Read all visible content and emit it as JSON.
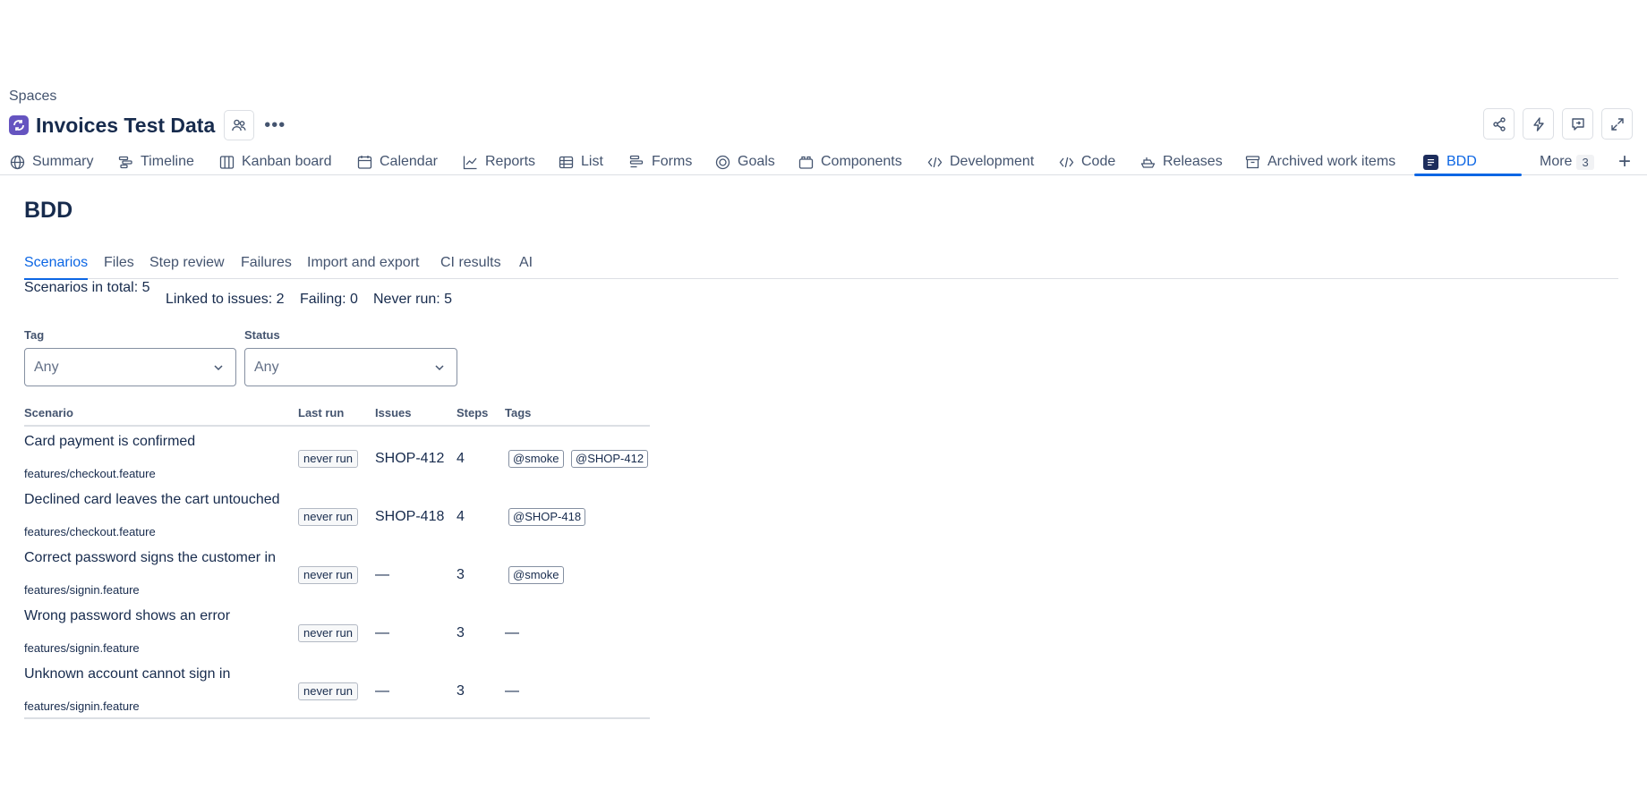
{
  "breadcrumb": "Spaces",
  "project": {
    "title": "Invoices Test Data"
  },
  "colors": {
    "accent": "#0c66e4",
    "project_avatar": "#6554c0",
    "bdd_icon": "#1d2d5c"
  },
  "header_actions": [
    "share-icon",
    "automation-icon",
    "feedback-icon",
    "fullscreen-icon"
  ],
  "nav": {
    "items": [
      {
        "label": "Summary",
        "icon": "globe-icon"
      },
      {
        "label": "Timeline",
        "icon": "timeline-icon"
      },
      {
        "label": "Kanban board",
        "icon": "board-icon"
      },
      {
        "label": "Calendar",
        "icon": "calendar-icon"
      },
      {
        "label": "Reports",
        "icon": "chart-icon"
      },
      {
        "label": "List",
        "icon": "list-icon"
      },
      {
        "label": "Forms",
        "icon": "forms-icon"
      },
      {
        "label": "Goals",
        "icon": "target-icon"
      },
      {
        "label": "Components",
        "icon": "components-icon"
      },
      {
        "label": "Development",
        "icon": "code-icon"
      },
      {
        "label": "Code",
        "icon": "code-icon"
      },
      {
        "label": "Releases",
        "icon": "ship-icon"
      },
      {
        "label": "Archived work items",
        "icon": "archive-icon"
      },
      {
        "label": "BDD",
        "icon": "bdd-icon",
        "active": true
      }
    ],
    "more_label": "More",
    "more_count": "3"
  },
  "page": {
    "heading": "BDD"
  },
  "subtabs": [
    "Scenarios",
    "Files",
    "Step review",
    "Failures",
    "Import and export",
    "CI results",
    "AI"
  ],
  "stats": {
    "total": "Scenarios in total: 5",
    "linked": "Linked to issues: 2",
    "failing": "Failing: 0",
    "never_run": "Never run: 5"
  },
  "filters": {
    "tag": {
      "label": "Tag",
      "value": "Any"
    },
    "status": {
      "label": "Status",
      "value": "Any"
    }
  },
  "table": {
    "headers": [
      "Scenario",
      "Last run",
      "Issues",
      "Steps",
      "Tags"
    ],
    "rows": [
      {
        "name": "Card payment is confirmed",
        "file": "features/checkout.feature",
        "last_run": "never run",
        "issue": "SHOP-412",
        "steps": "4",
        "tags": [
          "@smoke",
          "@SHOP-412"
        ]
      },
      {
        "name": "Declined card leaves the cart untouched",
        "file": "features/checkout.feature",
        "last_run": "never run",
        "issue": "SHOP-418",
        "steps": "4",
        "tags": [
          "@SHOP-418"
        ]
      },
      {
        "name": "Correct password signs the customer in",
        "file": "features/signin.feature",
        "last_run": "never run",
        "issue": "—",
        "steps": "3",
        "tags": [
          "@smoke"
        ]
      },
      {
        "name": "Wrong password shows an error",
        "file": "features/signin.feature",
        "last_run": "never run",
        "issue": "—",
        "steps": "3",
        "tags": [],
        "tags_empty": "—"
      },
      {
        "name": "Unknown account cannot sign in",
        "file": "features/signin.feature",
        "last_run": "never run",
        "issue": "—",
        "steps": "3",
        "tags": [],
        "tags_empty": "—"
      }
    ]
  }
}
